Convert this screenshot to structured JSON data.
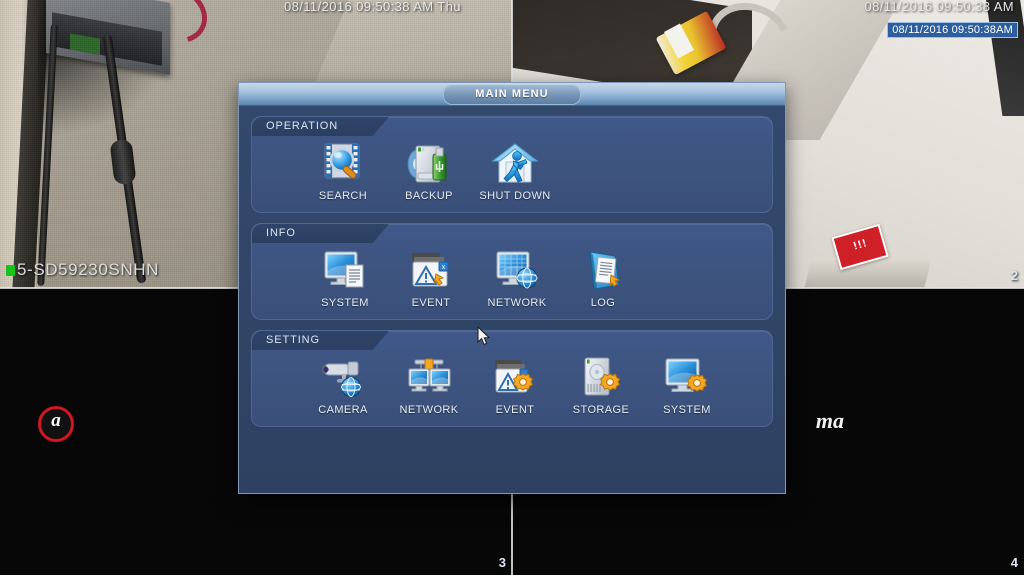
{
  "osd": {
    "time_left_pane": "08/11/2016 09:50:38 AM Thu",
    "time_right_pane": "08/11/2016 09:50:38 AM",
    "time_right_selected": "08/11/2016 09:50:38AM",
    "camera_name_pane1": "5-SD59230SNHN",
    "channel_numbers": {
      "pane2": "2",
      "pane3": "3",
      "pane4": "4"
    },
    "logo_left": "a",
    "logo_right": "ma"
  },
  "dialog": {
    "title": "MAIN MENU",
    "groups": [
      {
        "id": "operation",
        "label": "OPERATION",
        "items": [
          {
            "label": "SEARCH",
            "icon": "film-magnifier-icon"
          },
          {
            "label": "BACKUP",
            "icon": "disk-usb-icon"
          },
          {
            "label": "SHUT DOWN",
            "icon": "house-exit-icon"
          }
        ]
      },
      {
        "id": "info",
        "label": "INFO",
        "items": [
          {
            "label": "SYSTEM",
            "icon": "monitor-document-icon"
          },
          {
            "label": "EVENT",
            "icon": "folder-warning-icon"
          },
          {
            "label": "NETWORK",
            "icon": "monitor-globe-icon"
          },
          {
            "label": "LOG",
            "icon": "logbook-icon"
          }
        ]
      },
      {
        "id": "setting",
        "label": "SETTING",
        "items": [
          {
            "label": "CAMERA",
            "icon": "bullet-camera-globe-icon"
          },
          {
            "label": "NETWORK",
            "icon": "dual-monitor-link-icon"
          },
          {
            "label": "EVENT",
            "icon": "folder-warning-gear-icon"
          },
          {
            "label": "STORAGE",
            "icon": "harddisk-gear-icon"
          },
          {
            "label": "SYSTEM",
            "icon": "monitor-gear-icon"
          }
        ]
      }
    ]
  },
  "colors": {
    "dialog_bg": "#2e4162",
    "group_bg": "#3e5582",
    "titlebar": "#a6c2dd",
    "accent_gear": "#f2a91b",
    "accent_green": "#3f9e34",
    "label_text": "#e7edf5",
    "selection_blue": "#2d5f9e"
  }
}
